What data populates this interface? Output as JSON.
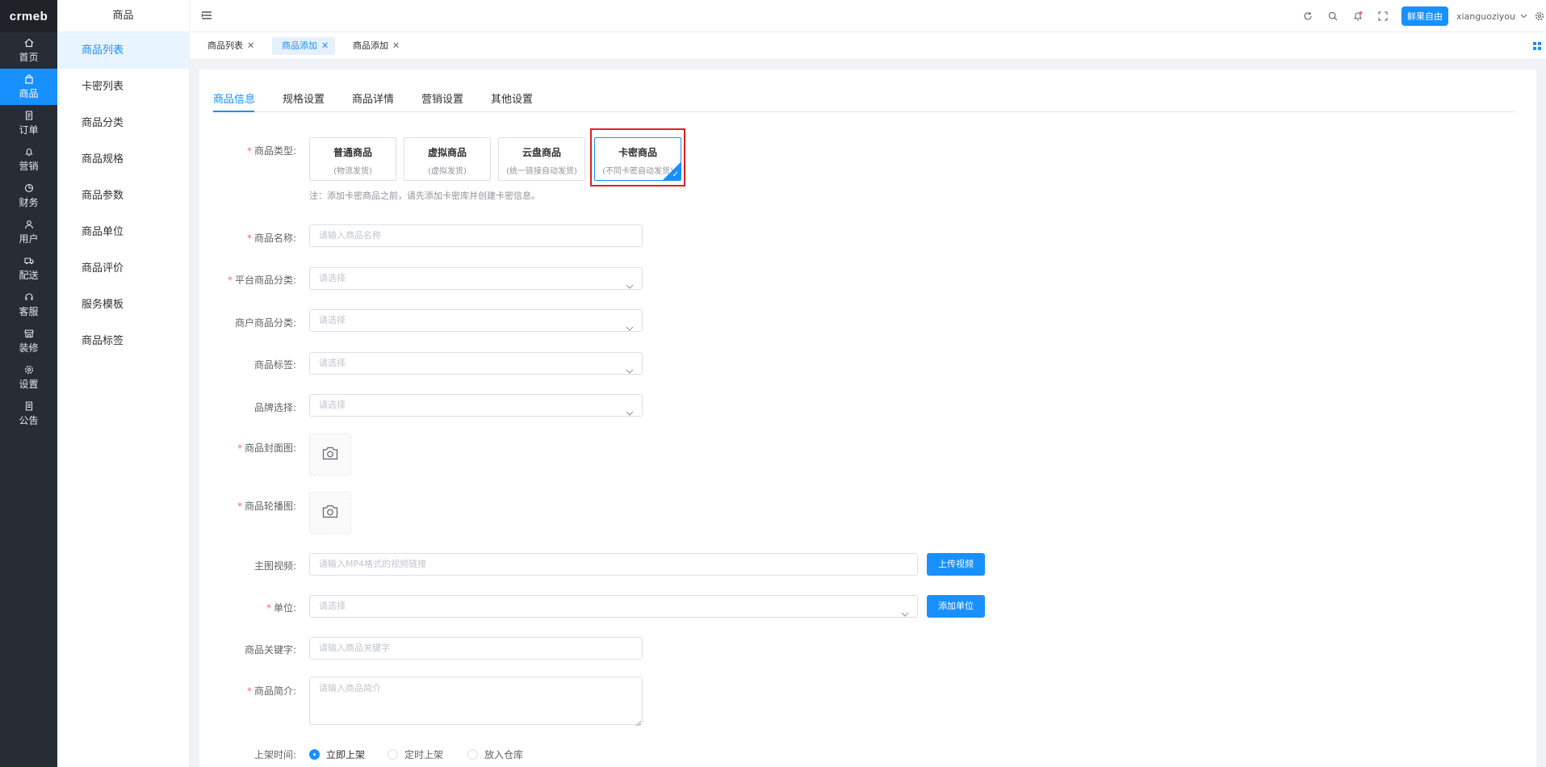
{
  "brand": {
    "logo_text": "crmeb"
  },
  "rail": [
    {
      "label": "首页",
      "icon": "home-icon"
    },
    {
      "label": "商品",
      "icon": "bag-icon",
      "active": true
    },
    {
      "label": "订单",
      "icon": "document-icon"
    },
    {
      "label": "营销",
      "icon": "bell-icon"
    },
    {
      "label": "财务",
      "icon": "chart-icon"
    },
    {
      "label": "用户",
      "icon": "user-icon"
    },
    {
      "label": "配送",
      "icon": "truck-icon"
    },
    {
      "label": "客服",
      "icon": "headset-icon"
    },
    {
      "label": "装修",
      "icon": "shop-icon"
    },
    {
      "label": "设置",
      "icon": "gear-icon"
    },
    {
      "label": "公告",
      "icon": "notice-icon"
    }
  ],
  "submenu": {
    "title": "商品",
    "items": [
      "商品列表",
      "卡密列表",
      "商品分类",
      "商品规格",
      "商品参数",
      "商品单位",
      "商品评价",
      "服务模板",
      "商品标签"
    ]
  },
  "header": {
    "store_name": "鲜果自由",
    "username": "xianguoziyou",
    "icons": [
      "refresh-icon",
      "search-icon",
      "notification-icon",
      "fullscreen-icon"
    ]
  },
  "tags": [
    {
      "label": "商品列表"
    },
    {
      "label": "商品添加",
      "active": true
    },
    {
      "label": "商品添加"
    }
  ],
  "tabs": [
    "商品信息",
    "规格设置",
    "商品详情",
    "营销设置",
    "其他设置"
  ],
  "form": {
    "type": {
      "label": "商品类型:",
      "options": [
        {
          "title": "普通商品",
          "sub": "(物流发货)"
        },
        {
          "title": "虚拟商品",
          "sub": "(虚拟发货)"
        },
        {
          "title": "云盘商品",
          "sub": "(统一链接自动发货)"
        },
        {
          "title": "卡密商品",
          "sub": "(不同卡密自动发货)",
          "selected": true
        }
      ],
      "note": "注：添加卡密商品之前，请先添加卡密库并创建卡密信息。"
    },
    "name": {
      "label": "商品名称:",
      "placeholder": "请输入商品名称"
    },
    "platform_category": {
      "label": "平台商品分类:",
      "placeholder": "请选择"
    },
    "merchant_category": {
      "label": "商户商品分类:",
      "placeholder": "请选择"
    },
    "tags": {
      "label": "商品标签:",
      "placeholder": "请选择"
    },
    "brand": {
      "label": "品牌选择:",
      "placeholder": "请选择"
    },
    "cover": {
      "label": "商品封面图:"
    },
    "carousel": {
      "label": "商品轮播图:"
    },
    "video": {
      "label": "主图视频:",
      "placeholder": "请输入MP4格式的视频链接",
      "button": "上传视频"
    },
    "unit": {
      "label": "单位:",
      "placeholder": "请选择",
      "button": "添加单位"
    },
    "keywords": {
      "label": "商品关键字:",
      "placeholder": "请输入商品关键字"
    },
    "intro": {
      "label": "商品简介:",
      "placeholder": "请输入商品简介"
    },
    "shelf": {
      "label": "上架时间:",
      "options": [
        "立即上架",
        "定时上架",
        "放入仓库"
      ],
      "selected": "立即上架"
    }
  },
  "colors": {
    "primary": "#1890ff",
    "rail_bg": "#282c34",
    "required": "#f56c6c",
    "highlight": "#e02020"
  }
}
